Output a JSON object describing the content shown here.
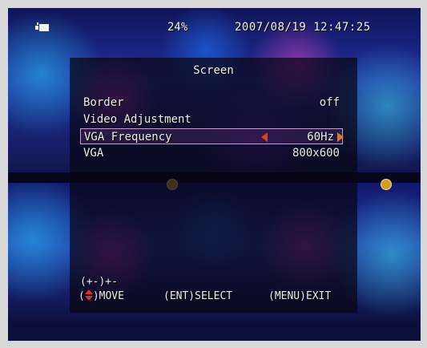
{
  "status_bar": {
    "icon": "camera-icon",
    "battery_percent": "24%",
    "datetime": "2007/08/19 12:47:25"
  },
  "menu": {
    "title": "Screen",
    "items": [
      {
        "label": "Border",
        "value": "off"
      },
      {
        "label": "Video Adjustment",
        "value": ""
      },
      {
        "label": "VGA Frequency",
        "value": "60Hz",
        "selected": true
      },
      {
        "label": "VGA",
        "value": "800x600"
      }
    ],
    "adjust_hint": "(+-)+-",
    "nav": {
      "move_prefix": "(",
      "move_label": ")MOVE",
      "select": "(ENT)SELECT",
      "exit": "(MENU)EXIT"
    }
  },
  "colors": {
    "arrow_left": "#e04020",
    "arrow_right": "#e07820",
    "selection_border": "#c0a0d0",
    "text": "#efefef"
  }
}
